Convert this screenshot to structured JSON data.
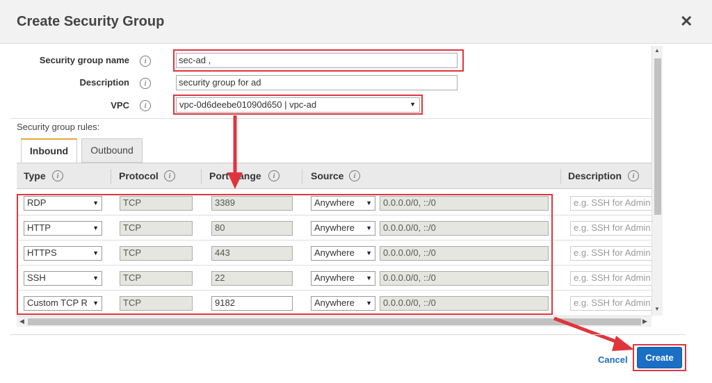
{
  "dialog": {
    "title": "Create Security Group",
    "close_glyph": "✕"
  },
  "form": {
    "name_label": "Security group name",
    "name_value": "sec-ad        ,",
    "description_label": "Description",
    "description_value": "security group for ad",
    "vpc_label": "VPC",
    "vpc_value": "vpc-0d6deebe01090d650 | vpc-ad",
    "info_glyph": "i"
  },
  "rules": {
    "label": "Security group rules:",
    "tabs": [
      {
        "label": "Inbound",
        "active": true
      },
      {
        "label": "Outbound",
        "active": false
      }
    ],
    "columns": [
      "Type",
      "Protocol",
      "Port Range",
      "Source",
      "Description"
    ],
    "rows": [
      {
        "type": "RDP",
        "protocol": "TCP",
        "port": "3389",
        "port_editable": false,
        "source": "Anywhere",
        "cidr": "0.0.0.0/0, ::/0",
        "description_placeholder": "e.g. SSH for Admin"
      },
      {
        "type": "HTTP",
        "protocol": "TCP",
        "port": "80",
        "port_editable": false,
        "source": "Anywhere",
        "cidr": "0.0.0.0/0, ::/0",
        "description_placeholder": "e.g. SSH for Admin"
      },
      {
        "type": "HTTPS",
        "protocol": "TCP",
        "port": "443",
        "port_editable": false,
        "source": "Anywhere",
        "cidr": "0.0.0.0/0, ::/0",
        "description_placeholder": "e.g. SSH for Admin"
      },
      {
        "type": "SSH",
        "protocol": "TCP",
        "port": "22",
        "port_editable": false,
        "source": "Anywhere",
        "cidr": "0.0.0.0/0, ::/0",
        "description_placeholder": "e.g. SSH for Admin"
      },
      {
        "type": "Custom TCP R",
        "protocol": "TCP",
        "port": "9182",
        "port_editable": true,
        "source": "Anywhere",
        "cidr": "0.0.0.0/0, ::/0",
        "description_placeholder": "e.g. SSH for Admin"
      }
    ]
  },
  "footer": {
    "cancel_label": "Cancel",
    "create_label": "Create"
  },
  "colors": {
    "annotation_red": "#e0343c",
    "primary_button": "#1a6fc4",
    "link": "#1a6ec2",
    "tab_accent": "#e7a33e"
  }
}
